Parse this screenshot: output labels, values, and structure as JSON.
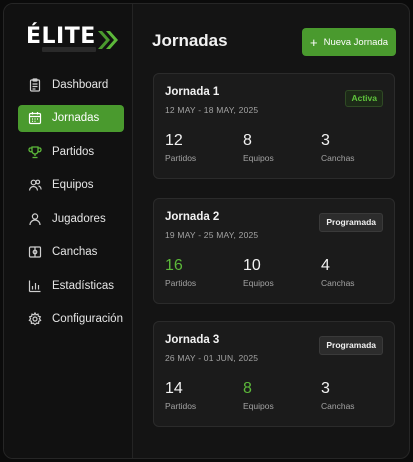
{
  "app": {
    "logo_text": "ÉLITE"
  },
  "sidebar": {
    "items": [
      {
        "label": "Dashboard",
        "icon": "clipboard-icon",
        "active": false
      },
      {
        "label": "Jornadas",
        "icon": "calendar-icon",
        "active": true
      },
      {
        "label": "Partidos",
        "icon": "trophy-icon",
        "active": false
      },
      {
        "label": "Equipos",
        "icon": "users-icon",
        "active": false
      },
      {
        "label": "Jugadores",
        "icon": "user-icon",
        "active": false
      },
      {
        "label": "Canchas",
        "icon": "field-icon",
        "active": false
      },
      {
        "label": "Estadísticas",
        "icon": "bar-chart-icon",
        "active": false
      },
      {
        "label": "Configuración",
        "icon": "gear-icon",
        "active": false
      }
    ]
  },
  "header": {
    "title": "Jornadas",
    "new_button_label": "Nueva Jornada"
  },
  "jornadas": [
    {
      "title": "Jornada 1",
      "dates": "12 MAY - 18 MAY, 2025",
      "status": "Activa",
      "stats": [
        {
          "value": "12",
          "label": "Partidos"
        },
        {
          "value": "8",
          "label": "Equipos"
        },
        {
          "value": "3",
          "label": "Canchas"
        }
      ]
    },
    {
      "title": "Jornada 2",
      "dates": "19 MAY - 25 MAY, 2025",
      "status": "Programada",
      "stats": [
        {
          "value": "16",
          "label": "Partidos"
        },
        {
          "value": "10",
          "label": "Equipos"
        },
        {
          "value": "4",
          "label": "Canchas"
        }
      ]
    },
    {
      "title": "Jornada 3",
      "dates": "26 MAY - 01 JUN, 2025",
      "status": "Programada",
      "stats": [
        {
          "value": "14",
          "label": "Partidos"
        },
        {
          "value": "8",
          "label": "Equipos"
        },
        {
          "value": "3",
          "label": "Canchas"
        }
      ]
    }
  ],
  "colors": {
    "accent": "#4a9a2e",
    "accent_text": "#5cb83a",
    "background": "#141414",
    "card": "#1b1b1b"
  }
}
